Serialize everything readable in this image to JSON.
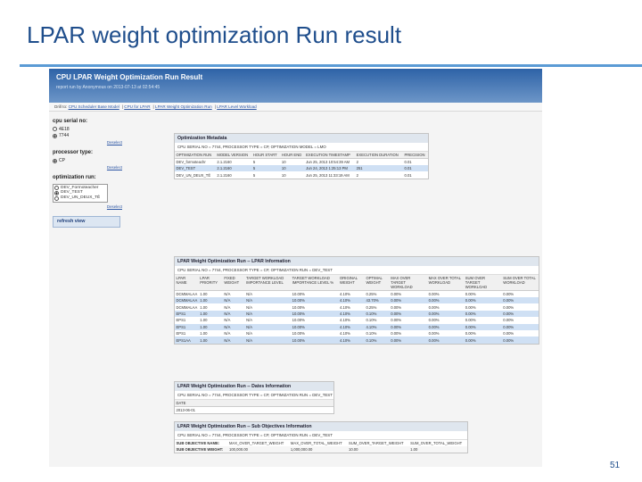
{
  "slide": {
    "title": "LPAR weight optimization Run result",
    "number": "51"
  },
  "app": {
    "title": "CPU LPAR Weight Optimization Run Result",
    "report_run_by": "report run by Anonymous on 2013-07-13 at 02:54:45",
    "nav_prefix": "Drill to:",
    "nav_links": [
      "CPU Scheduler Base Model",
      "CPU for LPAR",
      "LPAR Weight Optimization Run",
      "LPAR Level Workload"
    ],
    "nav_sep": "|"
  },
  "sidebar": {
    "cpu_serial": {
      "heading": "cpu serial no:",
      "options": [
        {
          "label": "4E18",
          "selected": false
        },
        {
          "label": "7744",
          "selected": true
        }
      ],
      "deselect": "Deselect"
    },
    "processor_type": {
      "heading": "processor type:",
      "options": [
        {
          "label": "CP",
          "selected": true
        }
      ],
      "deselect": "Deselect"
    },
    "optimization_run": {
      "heading": "optimization run:",
      "options": [
        {
          "label": "DEV_Formoteacher",
          "selected": false
        },
        {
          "label": "DEV_TEST",
          "selected": true
        },
        {
          "label": "DEV_UN_DEUX_TÊ",
          "selected": false
        }
      ],
      "deselect": "Deselect"
    },
    "refresh_label": "refresh view"
  },
  "metadata_panel": {
    "title": "Optimization Metadata",
    "subtitle": "CPU SERIAL NO = 7744, PROCESSOR TYPE = CP, OPTIMIZATION MODEL = LMO",
    "headers": [
      "OPTIMIZATION RUN",
      "MODEL VERSION",
      "HOUR START",
      "HOUR END",
      "EXECUTION TIMESTAMP",
      "EXECUTION DURATION",
      "PRECISION"
    ],
    "rows": [
      [
        "DEV_formoteachr",
        "2.1.2160",
        "5",
        "10",
        "Jun 25, 2013 10:54:39 AM",
        "2",
        "0.01"
      ],
      [
        "DEV_TEST",
        "2.1.2160",
        "5",
        "10",
        "Jun 24, 2013 1:25:13 PM",
        "251",
        "0.01"
      ],
      [
        "DEV_UN_DEUX_TÊ",
        "2.1.2160",
        "5",
        "10",
        "Jun 25, 2013 11:33:19 AM",
        "2",
        "0.01"
      ]
    ]
  },
  "lpar_panel": {
    "title": "LPAR Weight Optimization Run -- LPAR Information",
    "subtitle": "CPU SERIAL NO = 7744, PROCESSOR TYPE = CP, OPTIMIZATION RUN = DEV_TEST",
    "headers": [
      "LPAR NAME",
      "LPAR PRIORITY",
      "FIXED WEIGHT",
      "TARGET WORKLOAD IMPORTANCE LEVEL",
      "TARGET WORKLOAD IMPORTANCE LEVEL %",
      "ORIGINAL WEIGHT",
      "OPTIMAL WEIGHT",
      "MAX OVER TARGET WORKLOAD",
      "MAX OVER TOTAL WORKLOAD",
      "SUM OVER TARGET WORKLOAD",
      "SUM OVER TOTAL WORKLOAD"
    ],
    "rows": [
      [
        "DCMMALAA",
        "1.00",
        "N/A",
        "N/A",
        "10.00%",
        "4.10%",
        "0.25%",
        "0.00%",
        "0.00%",
        "0.00%",
        "0.00%"
      ],
      [
        "DCMMALAA",
        "1.00",
        "N/A",
        "N/A",
        "10.00%",
        "4.10%",
        "43.70%",
        "0.00%",
        "0.00%",
        "0.00%",
        "0.00%"
      ],
      [
        "DCMMALAA",
        "1.00",
        "N/A",
        "N/A",
        "10.00%",
        "4.10%",
        "0.25%",
        "0.00%",
        "0.00%",
        "0.00%",
        "0.00%"
      ],
      [
        "EPS1",
        "1.00",
        "N/A",
        "N/A",
        "10.00%",
        "4.10%",
        "0.10%",
        "0.00%",
        "0.00%",
        "0.00%",
        "0.00%"
      ],
      [
        "EPS1",
        "1.00",
        "N/A",
        "N/A",
        "10.00%",
        "4.10%",
        "0.10%",
        "0.00%",
        "0.00%",
        "0.00%",
        "0.00%"
      ],
      [
        "EPS1",
        "1.00",
        "N/A",
        "N/A",
        "10.00%",
        "4.10%",
        "4.10%",
        "0.00%",
        "0.00%",
        "0.00%",
        "0.00%"
      ],
      [
        "EPS1",
        "1.00",
        "N/A",
        "N/A",
        "10.00%",
        "4.10%",
        "0.10%",
        "0.00%",
        "0.00%",
        "0.00%",
        "0.00%"
      ],
      [
        "EPS1AA",
        "1.00",
        "N/A",
        "N/A",
        "10.00%",
        "4.10%",
        "0.10%",
        "0.00%",
        "0.00%",
        "0.00%",
        "0.00%"
      ]
    ]
  },
  "dates_panel": {
    "title": "LPAR Weight Optimization Run -- Dates Information",
    "subtitle": "CPU SERIAL NO = 7744, PROCESSOR TYPE = CP, OPTIMIZATION RUN = DEV_TEST",
    "headers": [
      "DATE"
    ],
    "rows": [
      [
        "2013-06-01"
      ]
    ]
  },
  "subobj_panel": {
    "title": "LPAR Weight Optimization Run -- Sub Objectives Information",
    "subtitle": "CPU SERIAL NO = 7744, PROCESSOR TYPE = CP, OPTIMIZATION RUN = DEV_TEST",
    "rows": [
      [
        "SUB OBJECTIVE NAME:",
        "MAX_OVER_TARGET_WEIGHT",
        "MAX_OVER_TOTAL_WEIGHT",
        "SUM_OVER_TARGET_WEIGHT",
        "SUM_OVER_TOTAL_WEIGHT"
      ],
      [
        "SUB OBJECTIVE WEIGHT:",
        "100,000.00",
        "1,000,000.00",
        "10.00",
        "1.00"
      ]
    ]
  }
}
